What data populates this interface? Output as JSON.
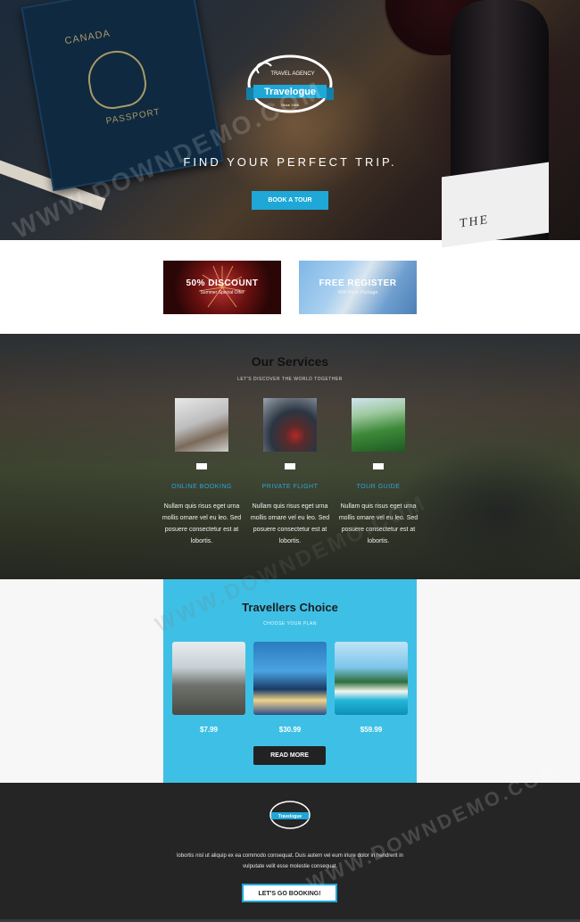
{
  "hero": {
    "logo_top_text": "TRAVEL AGENCY",
    "logo_name": "Travelogue",
    "logo_since": "Since 1988",
    "passport_text_1": "CANADA",
    "passport_text_2": "PASSPORT",
    "bottle_label": "THE",
    "tagline": "FIND YOUR PERFECT TRIP.",
    "button_label": "BOOK A TOUR"
  },
  "promos": [
    {
      "title": "50% DISCOUNT",
      "subtitle": "Summer Special Offer"
    },
    {
      "title": "FREE REGISTER",
      "subtitle": "With Basic Package"
    }
  ],
  "services": {
    "title": "Our Services",
    "subtitle": "LET'S DISCOVER THE WORLD TOGETHER",
    "items": [
      {
        "label": "ONLINE BOOKING",
        "text": "Nullam quis risus eget urna mollis ornare vel eu leo. Sed posuere consectetur est at lobortis."
      },
      {
        "label": "PRIVATE FLIGHT",
        "text": "Nullam quis risus eget urna mollis ornare vel eu leo. Sed posuere consectetur est at lobortis."
      },
      {
        "label": "TOUR GUIDE",
        "text": "Nullam quis risus eget urna mollis ornare vel eu leo. Sed posuere consectetur est at lobortis."
      }
    ]
  },
  "choice": {
    "title": "Travellers Choice",
    "subtitle": "CHOOSE YOUR PLAN",
    "prices": [
      "$7.99",
      "$30.99",
      "$59.99"
    ],
    "button_label": "READ MORE"
  },
  "footer": {
    "logo_name": "Travelogue",
    "text_line_1": "lobortis nisl ut aliquip ex ea commodo consequat. Duis autem vel eum iriure dolor in hendrerit in",
    "text_line_2": "vulputate velit esse molestie consequat.",
    "button_label": "LET'S GO BOOKING!"
  },
  "watermark": "WWW.DOWNDEMO.COM",
  "colors": {
    "accent": "#1ea7d7",
    "choice_bg": "#3ec0e6",
    "footer_bg": "#252525"
  }
}
